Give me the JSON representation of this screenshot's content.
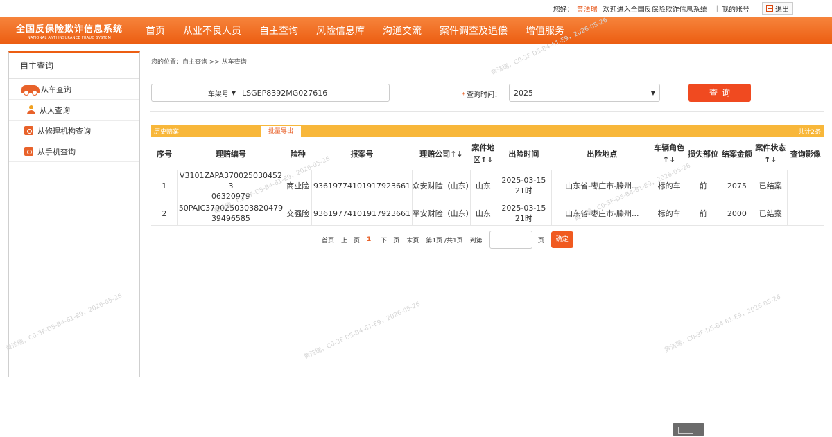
{
  "topbar": {
    "greeting": "您好：",
    "username": "黄法瑞",
    "welcome": "欢迎进入全国反保险欺诈信息系统",
    "separator": "|",
    "my_account": "我的账号",
    "logout": "退出"
  },
  "logo": {
    "cn": "全国反保险欺诈信息系统",
    "en": "NATIONAL ANTI INSURANCE FRAUD SYSTEM"
  },
  "nav": [
    "首页",
    "从业不良人员",
    "自主查询",
    "风险信息库",
    "沟通交流",
    "案件调查及追偿",
    "增值服务"
  ],
  "sidebar": {
    "title": "自主查询",
    "items": [
      {
        "label": "从车查询",
        "icon": "car-icon"
      },
      {
        "label": "从人查询",
        "icon": "person-icon"
      },
      {
        "label": "从修理机构查询",
        "icon": "repair-icon"
      },
      {
        "label": "从手机查询",
        "icon": "phone-icon"
      }
    ]
  },
  "breadcrumb": "您的位置：自主查询 >> 从车查询",
  "search": {
    "type_selected": "车架号",
    "vin_value": "LSGEP8392MG027616",
    "time_required_mark": "*",
    "time_label": "查询时间：",
    "time_selected": "2025",
    "query_button": "查询"
  },
  "table": {
    "history_label": "历史赔案",
    "export_label": "批量导出",
    "total_label": "共计2条",
    "columns": [
      "序号",
      "理赔编号",
      "险种",
      "报案号",
      "理赔公司↑↓",
      "案件地区↑↓",
      "出险时间",
      "出险地点",
      "车辆角色↑↓",
      "损失部位",
      "结案金额",
      "案件状态↑↓",
      "查询影像"
    ],
    "rows": [
      [
        "1",
        "V3101ZAPA370025030452306320979",
        "商业险",
        "93619774101917923661",
        "众安财险（山东）",
        "山东",
        "2025-03-15 21时",
        "山东省-枣庄市-滕州...",
        "标的车",
        "前",
        "2075",
        "已结案",
        ""
      ],
      [
        "2",
        "50PAIC370025030382047939496585",
        "交强险",
        "93619774101917923661",
        "平安财险（山东）",
        "山东",
        "2025-03-15 21时",
        "山东省-枣庄市-滕州...",
        "标的车",
        "前",
        "2000",
        "已结案",
        ""
      ]
    ]
  },
  "pager": {
    "first": "首页",
    "prev": "上一页",
    "current": "1",
    "next": "下一页",
    "last": "末页",
    "info": "第1页 /共1页",
    "goto": "到第",
    "page_unit": "页",
    "confirm": "确定"
  },
  "watermark": "黄法瑞，C0-3F-D5-B4-61-E9，2026-05-26",
  "colors": {
    "brand": "#ec5e12",
    "accent": "#f8b73a",
    "button": "#f04a20"
  }
}
